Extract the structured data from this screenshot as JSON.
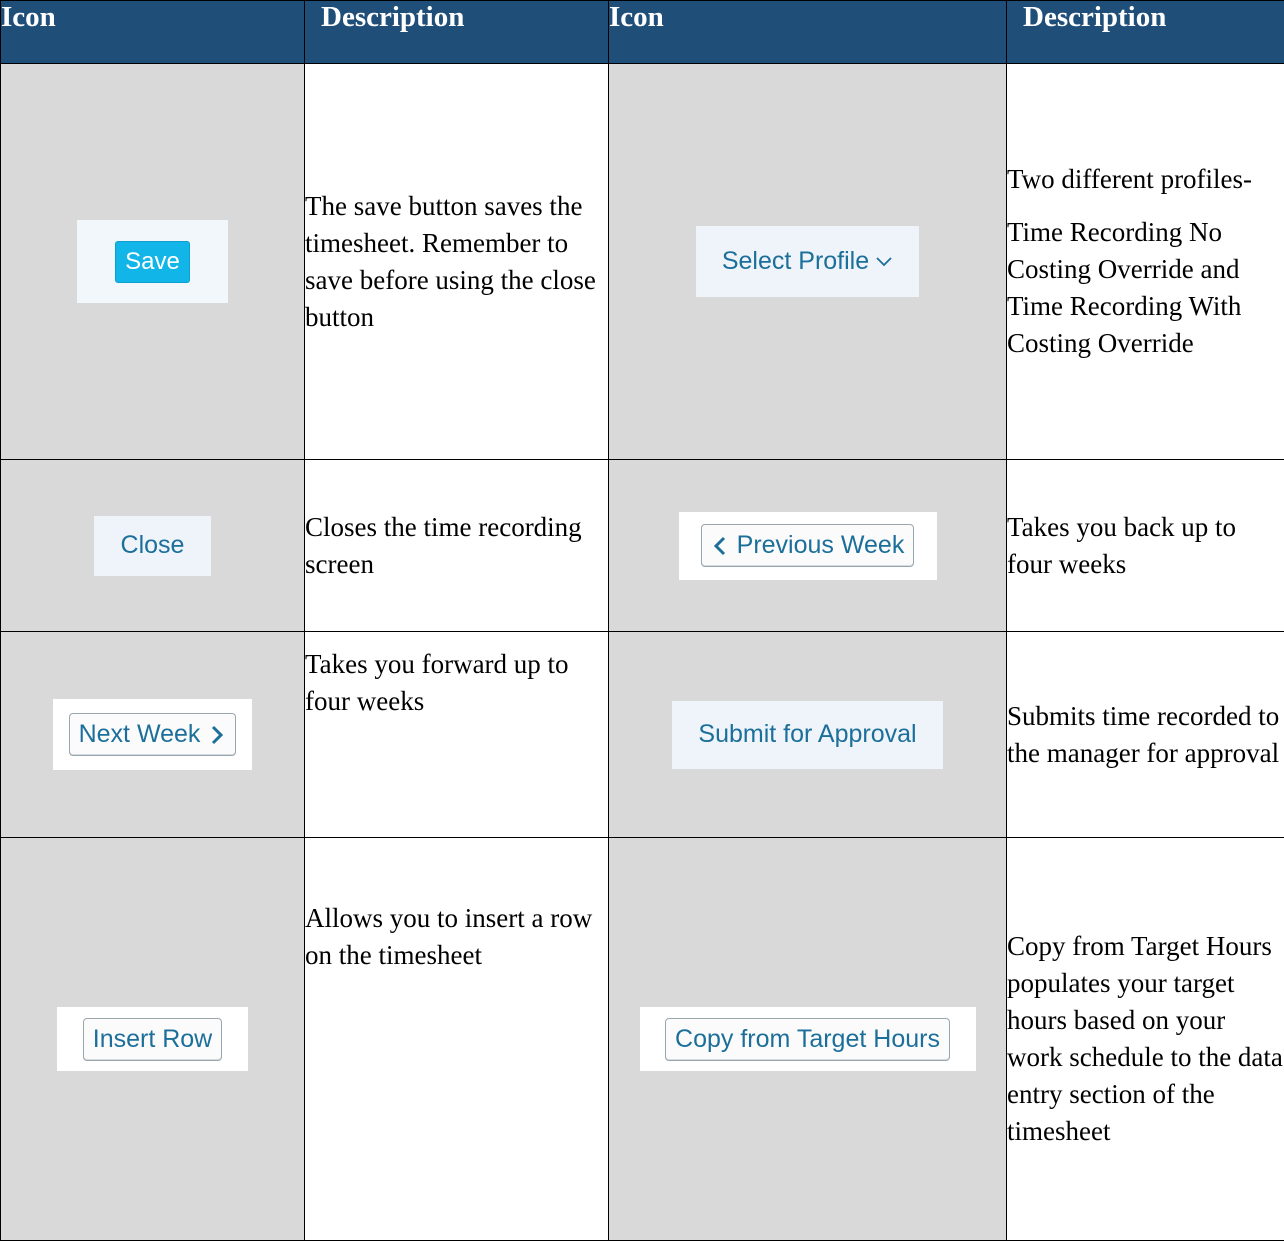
{
  "table": {
    "headers": [
      "Icon",
      "Description",
      "Icon",
      "Description"
    ],
    "rows": [
      {
        "left_button": "Save",
        "left_description": "The save button saves the timesheet. Remember to save before using the close button",
        "right_button": "Select Profile",
        "right_description_line1": "Two different profiles-",
        "right_description_line2": "Time Recording No Costing Override and Time Recording With Costing Override"
      },
      {
        "left_button": "Close",
        "left_description": "Closes the time recording screen",
        "right_button": "Previous Week",
        "right_description": "Takes you back up to four weeks"
      },
      {
        "left_button": "Next Week",
        "left_description": "Takes you forward up to four weeks",
        "right_button": "Submit for Approval",
        "right_description": "Submits time recorded to the manager for approval"
      },
      {
        "left_button": "Insert Row",
        "left_description": "Allows you to insert a row on the timesheet",
        "right_button": "Copy from Target Hours",
        "right_description": "Copy from Target Hours populates your target hours based on your work schedule to the data entry section of the timesheet"
      }
    ]
  },
  "icons": {
    "select_profile": "chevron-down-icon",
    "previous_week": "chevron-left-icon",
    "next_week": "chevron-right-icon"
  },
  "colors": {
    "header_bg": "#1f4e79",
    "icon_cell_bg": "#d9d9d9",
    "primary_button": "#12b5e8",
    "link_text": "#1b6f9a"
  }
}
